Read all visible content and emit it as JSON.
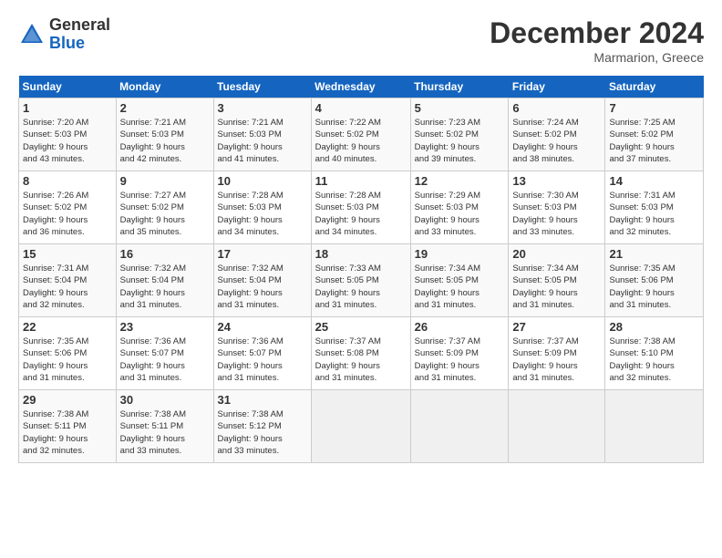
{
  "logo": {
    "general": "General",
    "blue": "Blue"
  },
  "header": {
    "title": "December 2024",
    "location": "Marmarion, Greece"
  },
  "days_of_week": [
    "Sunday",
    "Monday",
    "Tuesday",
    "Wednesday",
    "Thursday",
    "Friday",
    "Saturday"
  ],
  "weeks": [
    [
      {
        "day": "1",
        "info": "Sunrise: 7:20 AM\nSunset: 5:03 PM\nDaylight: 9 hours\nand 43 minutes."
      },
      {
        "day": "2",
        "info": "Sunrise: 7:21 AM\nSunset: 5:03 PM\nDaylight: 9 hours\nand 42 minutes."
      },
      {
        "day": "3",
        "info": "Sunrise: 7:21 AM\nSunset: 5:03 PM\nDaylight: 9 hours\nand 41 minutes."
      },
      {
        "day": "4",
        "info": "Sunrise: 7:22 AM\nSunset: 5:02 PM\nDaylight: 9 hours\nand 40 minutes."
      },
      {
        "day": "5",
        "info": "Sunrise: 7:23 AM\nSunset: 5:02 PM\nDaylight: 9 hours\nand 39 minutes."
      },
      {
        "day": "6",
        "info": "Sunrise: 7:24 AM\nSunset: 5:02 PM\nDaylight: 9 hours\nand 38 minutes."
      },
      {
        "day": "7",
        "info": "Sunrise: 7:25 AM\nSunset: 5:02 PM\nDaylight: 9 hours\nand 37 minutes."
      }
    ],
    [
      {
        "day": "8",
        "info": "Sunrise: 7:26 AM\nSunset: 5:02 PM\nDaylight: 9 hours\nand 36 minutes."
      },
      {
        "day": "9",
        "info": "Sunrise: 7:27 AM\nSunset: 5:02 PM\nDaylight: 9 hours\nand 35 minutes."
      },
      {
        "day": "10",
        "info": "Sunrise: 7:28 AM\nSunset: 5:03 PM\nDaylight: 9 hours\nand 34 minutes."
      },
      {
        "day": "11",
        "info": "Sunrise: 7:28 AM\nSunset: 5:03 PM\nDaylight: 9 hours\nand 34 minutes."
      },
      {
        "day": "12",
        "info": "Sunrise: 7:29 AM\nSunset: 5:03 PM\nDaylight: 9 hours\nand 33 minutes."
      },
      {
        "day": "13",
        "info": "Sunrise: 7:30 AM\nSunset: 5:03 PM\nDaylight: 9 hours\nand 33 minutes."
      },
      {
        "day": "14",
        "info": "Sunrise: 7:31 AM\nSunset: 5:03 PM\nDaylight: 9 hours\nand 32 minutes."
      }
    ],
    [
      {
        "day": "15",
        "info": "Sunrise: 7:31 AM\nSunset: 5:04 PM\nDaylight: 9 hours\nand 32 minutes."
      },
      {
        "day": "16",
        "info": "Sunrise: 7:32 AM\nSunset: 5:04 PM\nDaylight: 9 hours\nand 31 minutes."
      },
      {
        "day": "17",
        "info": "Sunrise: 7:32 AM\nSunset: 5:04 PM\nDaylight: 9 hours\nand 31 minutes."
      },
      {
        "day": "18",
        "info": "Sunrise: 7:33 AM\nSunset: 5:05 PM\nDaylight: 9 hours\nand 31 minutes."
      },
      {
        "day": "19",
        "info": "Sunrise: 7:34 AM\nSunset: 5:05 PM\nDaylight: 9 hours\nand 31 minutes."
      },
      {
        "day": "20",
        "info": "Sunrise: 7:34 AM\nSunset: 5:05 PM\nDaylight: 9 hours\nand 31 minutes."
      },
      {
        "day": "21",
        "info": "Sunrise: 7:35 AM\nSunset: 5:06 PM\nDaylight: 9 hours\nand 31 minutes."
      }
    ],
    [
      {
        "day": "22",
        "info": "Sunrise: 7:35 AM\nSunset: 5:06 PM\nDaylight: 9 hours\nand 31 minutes."
      },
      {
        "day": "23",
        "info": "Sunrise: 7:36 AM\nSunset: 5:07 PM\nDaylight: 9 hours\nand 31 minutes."
      },
      {
        "day": "24",
        "info": "Sunrise: 7:36 AM\nSunset: 5:07 PM\nDaylight: 9 hours\nand 31 minutes."
      },
      {
        "day": "25",
        "info": "Sunrise: 7:37 AM\nSunset: 5:08 PM\nDaylight: 9 hours\nand 31 minutes."
      },
      {
        "day": "26",
        "info": "Sunrise: 7:37 AM\nSunset: 5:09 PM\nDaylight: 9 hours\nand 31 minutes."
      },
      {
        "day": "27",
        "info": "Sunrise: 7:37 AM\nSunset: 5:09 PM\nDaylight: 9 hours\nand 31 minutes."
      },
      {
        "day": "28",
        "info": "Sunrise: 7:38 AM\nSunset: 5:10 PM\nDaylight: 9 hours\nand 32 minutes."
      }
    ],
    [
      {
        "day": "29",
        "info": "Sunrise: 7:38 AM\nSunset: 5:11 PM\nDaylight: 9 hours\nand 32 minutes."
      },
      {
        "day": "30",
        "info": "Sunrise: 7:38 AM\nSunset: 5:11 PM\nDaylight: 9 hours\nand 33 minutes."
      },
      {
        "day": "31",
        "info": "Sunrise: 7:38 AM\nSunset: 5:12 PM\nDaylight: 9 hours\nand 33 minutes."
      },
      {
        "day": "",
        "info": ""
      },
      {
        "day": "",
        "info": ""
      },
      {
        "day": "",
        "info": ""
      },
      {
        "day": "",
        "info": ""
      }
    ]
  ]
}
